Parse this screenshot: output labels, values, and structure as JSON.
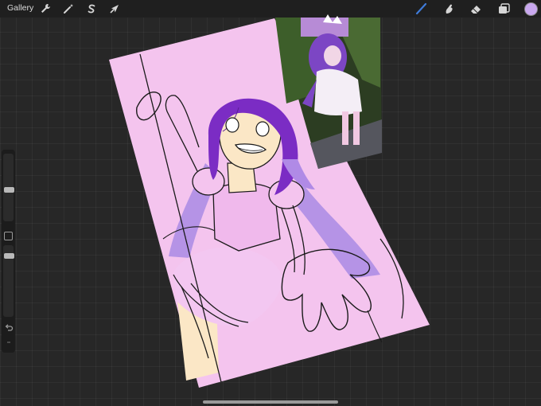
{
  "app": {
    "gallery_label": "Gallery"
  },
  "toolbar": {
    "left_tools": [
      "wrench-icon",
      "magic-wand-icon",
      "selection-icon",
      "transform-icon"
    ],
    "right_tools": [
      "brush-icon",
      "smudge-icon",
      "eraser-icon",
      "layers-icon"
    ],
    "active_tool": "brush-icon",
    "accent_color": "#3f7bd9",
    "current_color": "#c9a8ef"
  },
  "sidebar": {
    "brush_size_slider": {
      "value": 0.45
    },
    "opacity_slider": {
      "value": 0.9
    },
    "buttons": [
      "modify-button",
      "undo-button",
      "redo-button"
    ]
  },
  "canvas": {
    "page_color": "#f4c4ee",
    "hair_color": "#7b2cc4",
    "reference_photo": true
  }
}
